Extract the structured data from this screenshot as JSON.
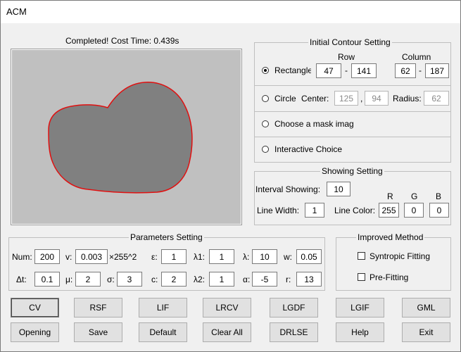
{
  "window": {
    "title": "ACM"
  },
  "status": "Completed! Cost Time: 0.439s",
  "initial_contour": {
    "title": "Initial Contour Setting",
    "row_label": "Row",
    "column_label": "Column",
    "rectangle": {
      "label": "Rectangle",
      "selected": true,
      "row_from": "47",
      "row_to": "141",
      "col_from": "62",
      "col_to": "187",
      "dash": "-"
    },
    "circle": {
      "label": "Circle",
      "center_label": "Center:",
      "center_x": "125",
      "comma": ",",
      "center_y": "94",
      "radius_label": "Radius:",
      "radius": "62"
    },
    "mask": {
      "label": "Choose a mask imag"
    },
    "interactive": {
      "label": "Interactive Choice"
    }
  },
  "showing": {
    "title": "Showing Setting",
    "interval_label": "Interval Showing:",
    "interval": "10",
    "line_width_label": "Line Width:",
    "line_width": "1",
    "line_color_label": "Line Color:",
    "r_label": "R",
    "g_label": "G",
    "b_label": "B",
    "r": "255",
    "g": "0",
    "b": "0"
  },
  "parameters": {
    "title": "Parameters Setting",
    "num_label": "Num:",
    "num": "200",
    "v_label": "v:",
    "v": "0.003",
    "v_suffix": "×255^2",
    "eps_label": "ε:",
    "eps": "1",
    "l1_label": "λ1:",
    "l1": "1",
    "lam_label": "λ:",
    "lam": "10",
    "w_label": "w:",
    "w": "0.05",
    "dt_label": "Δt:",
    "dt": "0.1",
    "mu_label": "μ:",
    "mu": "2",
    "sigma_label": "σ:",
    "sigma": "3",
    "c_label": "c:",
    "c": "2",
    "l2_label": "λ2:",
    "l2": "1",
    "alpha_label": "α:",
    "alpha": "-5",
    "r_label": "r:",
    "r": "13"
  },
  "improved": {
    "title": "Improved Method",
    "syntropic": "Syntropic Fitting",
    "prefitting": "Pre-Fitting"
  },
  "buttons_row1": [
    "CV",
    "RSF",
    "LIF",
    "LRCV",
    "LGDF",
    "LGIF",
    "GML"
  ],
  "buttons_row2": [
    "Opening",
    "Save",
    "Default",
    "Clear All",
    "DRLSE",
    "Help",
    "Exit"
  ],
  "colors": {
    "contour": "#e01010",
    "shape": "#808080",
    "canvas_bg": "#c0c0c0"
  }
}
